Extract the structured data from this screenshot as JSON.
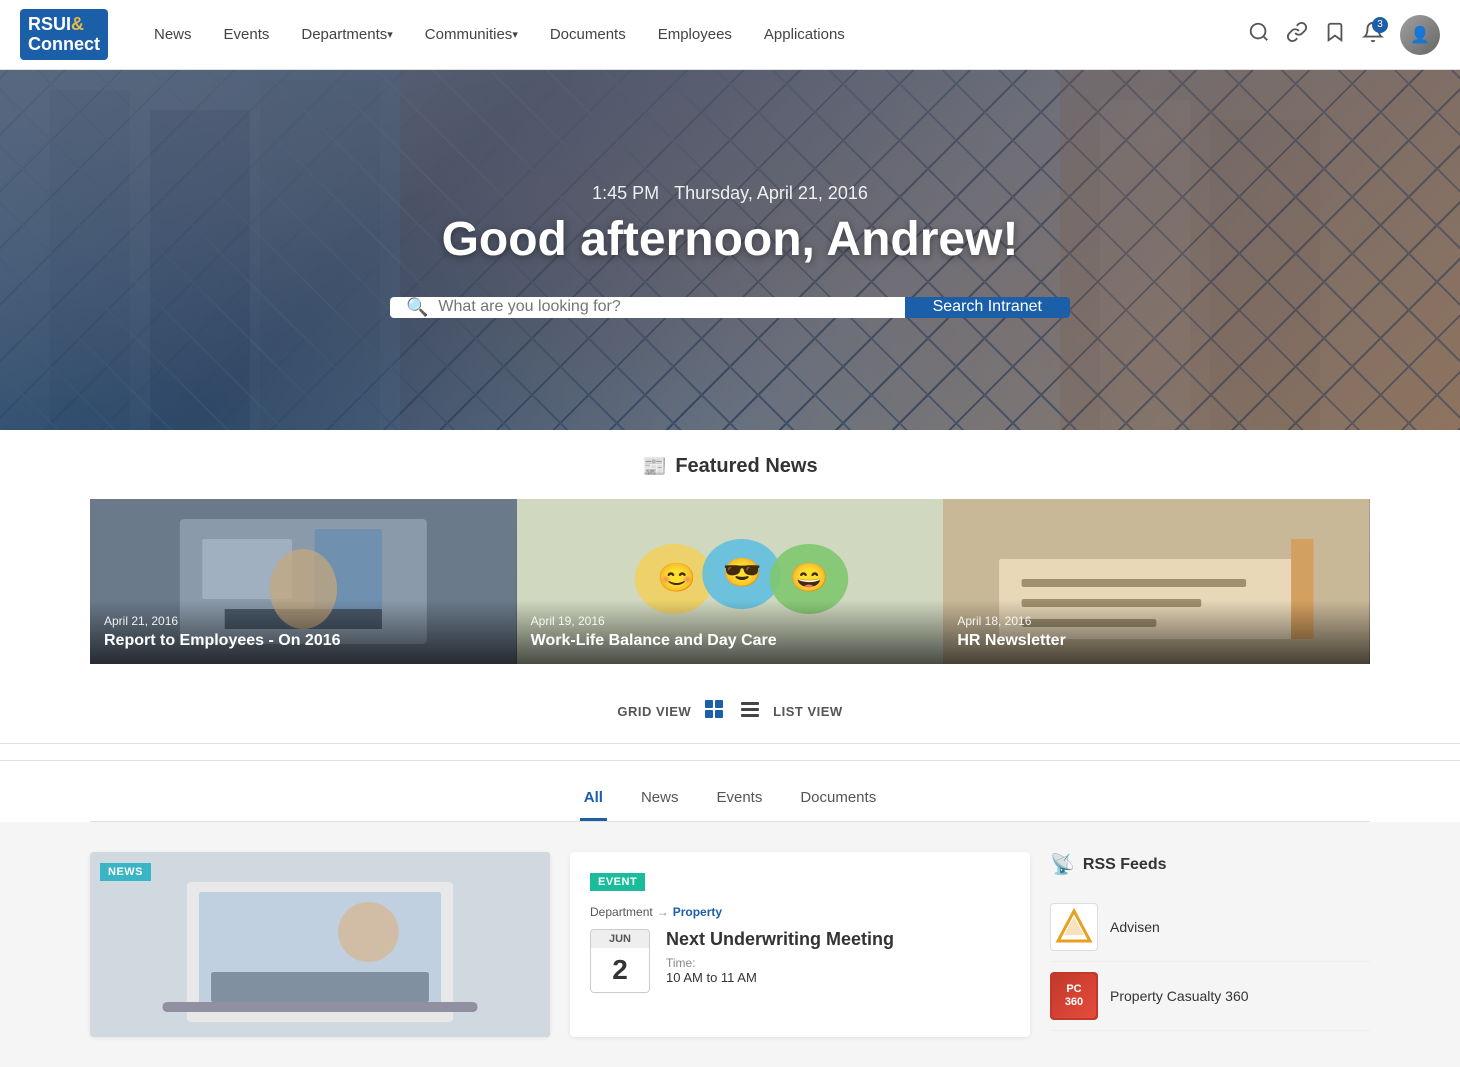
{
  "brand": {
    "logo_line1": "RSUI",
    "logo_amp": "&",
    "logo_line2": "Connect",
    "app_name": "RSUI Connect"
  },
  "nav": {
    "items": [
      {
        "label": "News",
        "hasArrow": false
      },
      {
        "label": "Events",
        "hasArrow": false
      },
      {
        "label": "Departments",
        "hasArrow": true
      },
      {
        "label": "Communities",
        "hasArrow": true
      },
      {
        "label": "Documents",
        "hasArrow": false
      },
      {
        "label": "Employees",
        "hasArrow": false
      },
      {
        "label": "Applications",
        "hasArrow": false
      }
    ],
    "notification_count": "3"
  },
  "hero": {
    "time": "1:45 PM",
    "day": "Thursday, April 21, 2016",
    "greeting": "Good afternoon, Andrew!",
    "search_placeholder": "What are you looking for?",
    "search_button": "Search Intranet"
  },
  "featured_news": {
    "section_title": "Featured News",
    "cards": [
      {
        "date": "April 21, 2016",
        "title": "Report to Employees - On 2016",
        "img_class": "img-biz"
      },
      {
        "date": "April 19, 2016",
        "title": "Work-Life Balance and Day Care",
        "img_class": "img-emoji"
      },
      {
        "date": "April 18, 2016",
        "title": "HR Newsletter",
        "img_class": "img-desk"
      }
    ]
  },
  "view_toggle": {
    "grid_label": "GRID VIEW",
    "list_label": "LIST VIEW"
  },
  "filter_tabs": [
    {
      "label": "All",
      "active": true
    },
    {
      "label": "News",
      "active": false
    },
    {
      "label": "Events",
      "active": false
    },
    {
      "label": "Documents",
      "active": false
    }
  ],
  "news_card": {
    "badge": "NEWS",
    "img_class": "img-laptop"
  },
  "event_card": {
    "badge": "EVENT",
    "dept_prefix": "Department",
    "dept_arrow": "→",
    "dept_name": "Property",
    "month": "JUN",
    "day": "2",
    "title": "Next Underwriting Meeting",
    "time_label": "Time:",
    "time": "10 AM to 11 AM"
  },
  "sidebar": {
    "rss_title": "RSS Feeds",
    "items": [
      {
        "name": "Advisen",
        "type": "advisen"
      },
      {
        "name": "Property Casualty 360",
        "type": "propcas"
      }
    ]
  }
}
